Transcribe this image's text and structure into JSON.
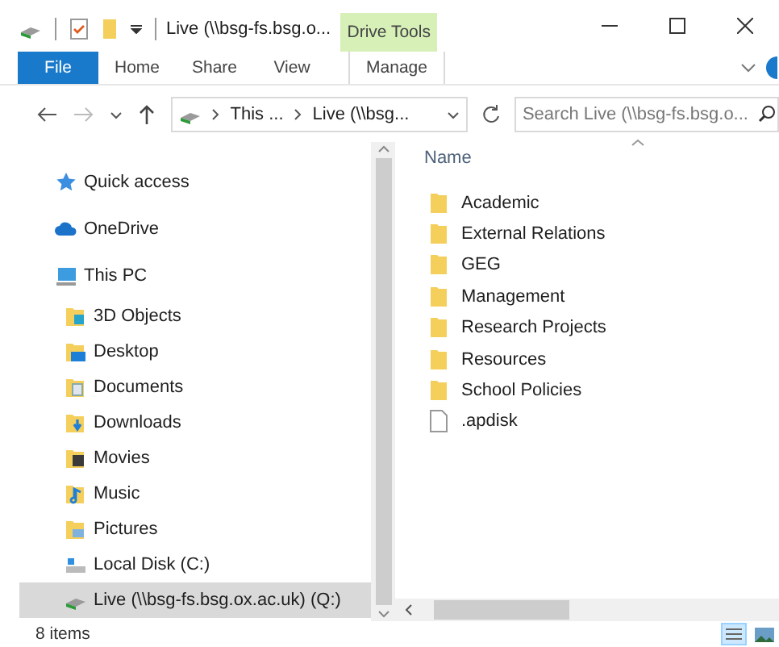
{
  "window": {
    "title": "Live (\\\\bsg-fs.bsg.o...",
    "context_tab": "Drive Tools"
  },
  "ribbon_tabs": [
    {
      "label": "File",
      "kind": "file"
    },
    {
      "label": "Home",
      "kind": "plain"
    },
    {
      "label": "Share",
      "kind": "plain"
    },
    {
      "label": "View",
      "kind": "plain"
    },
    {
      "label": "Manage",
      "kind": "context"
    }
  ],
  "address": {
    "crumbs": [
      "This ...",
      "Live (\\\\bsg..."
    ],
    "search_placeholder": "Search Live (\\\\bsg-fs.bsg.o..."
  },
  "sidebar": {
    "items": [
      {
        "label": "Quick access",
        "kind": "star",
        "selected": false
      },
      {
        "label": "OneDrive",
        "kind": "cloud",
        "selected": false
      },
      {
        "label": "This PC",
        "kind": "pc",
        "selected": false,
        "children": [
          {
            "label": "3D Objects",
            "kind": "cube",
            "selected": false
          },
          {
            "label": "Desktop",
            "kind": "desktop",
            "selected": false
          },
          {
            "label": "Documents",
            "kind": "documents",
            "selected": false
          },
          {
            "label": "Downloads",
            "kind": "downloads",
            "selected": false
          },
          {
            "label": "Movies",
            "kind": "movies",
            "selected": false
          },
          {
            "label": "Music",
            "kind": "music",
            "selected": false
          },
          {
            "label": "Pictures",
            "kind": "pictures",
            "selected": false
          },
          {
            "label": "Local Disk (C:)",
            "kind": "disk",
            "selected": false
          },
          {
            "label": "Live (\\\\bsg-fs.bsg.ox.ac.uk) (Q:)",
            "kind": "netdrive",
            "selected": true
          }
        ]
      }
    ]
  },
  "file_list": {
    "column": "Name",
    "rows": [
      {
        "name": "Academic",
        "kind": "folder"
      },
      {
        "name": "External Relations",
        "kind": "folder"
      },
      {
        "name": "GEG",
        "kind": "folder"
      },
      {
        "name": "Management",
        "kind": "folder"
      },
      {
        "name": "Research Projects",
        "kind": "folder"
      },
      {
        "name": "Resources",
        "kind": "folder"
      },
      {
        "name": "School Policies",
        "kind": "folder"
      },
      {
        "name": ".apdisk",
        "kind": "file"
      }
    ]
  },
  "status_bar": {
    "count": "8 items"
  }
}
